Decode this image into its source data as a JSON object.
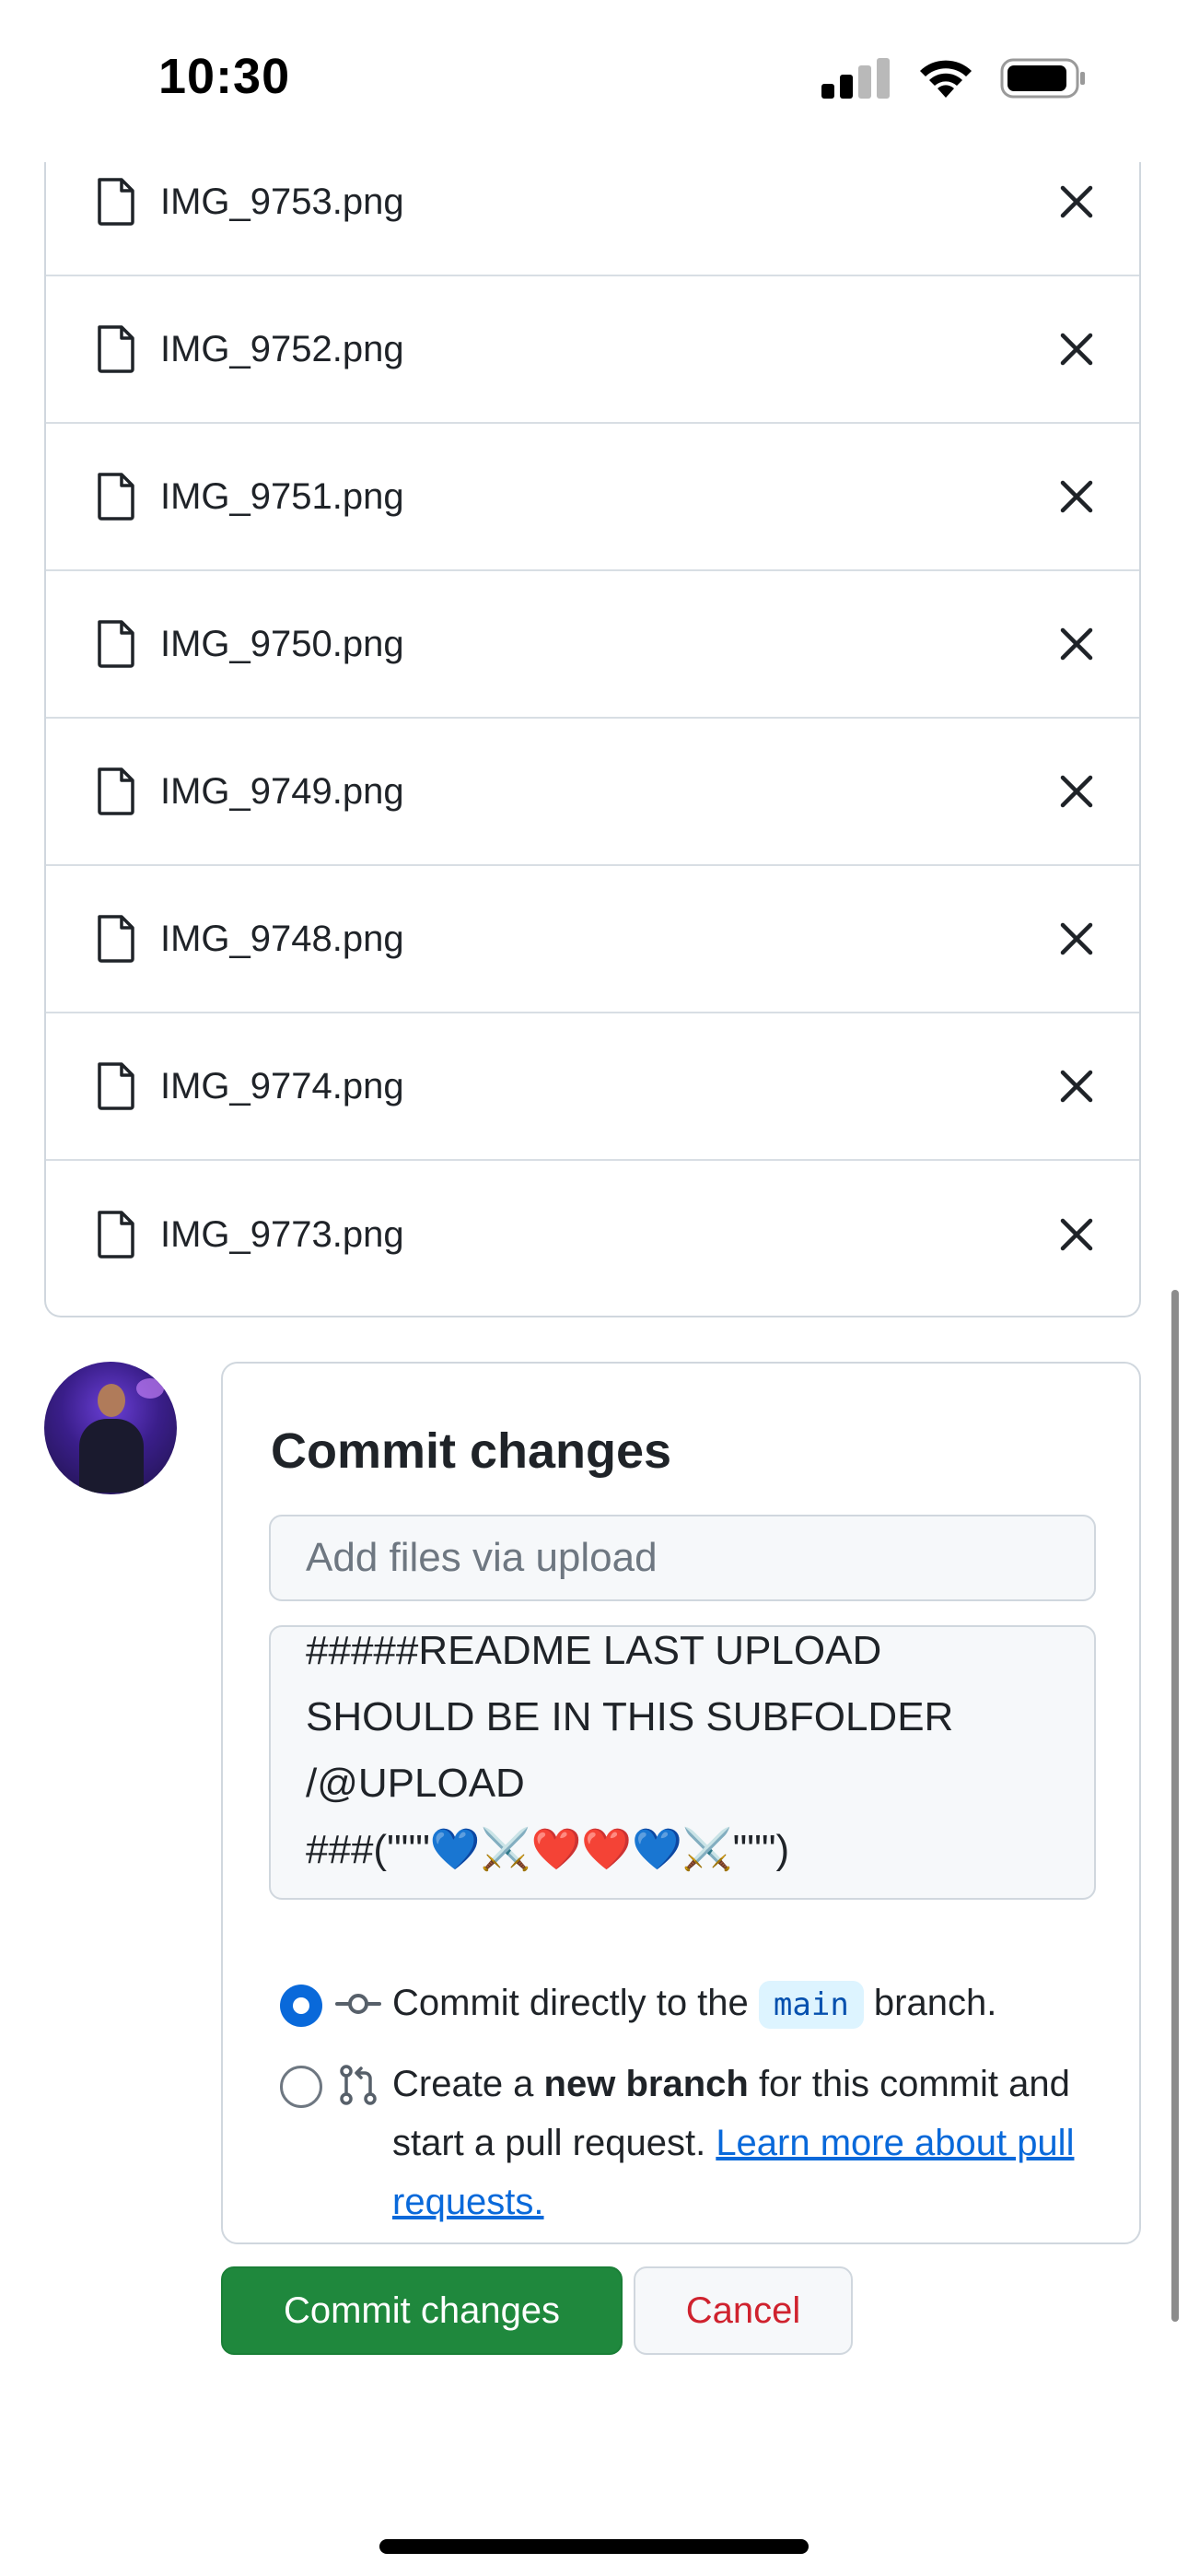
{
  "status_bar": {
    "time": "10:30"
  },
  "files": [
    {
      "name": "IMG_9753.png"
    },
    {
      "name": "IMG_9752.png"
    },
    {
      "name": "IMG_9751.png"
    },
    {
      "name": "IMG_9750.png"
    },
    {
      "name": "IMG_9749.png"
    },
    {
      "name": "IMG_9748.png"
    },
    {
      "name": "IMG_9774.png"
    },
    {
      "name": "IMG_9773.png"
    }
  ],
  "commit": {
    "title": "Commit changes",
    "summary_placeholder": "Add files via upload",
    "description_lines": [
      "#####README LAST UPLOAD",
      "SHOULD BE IN THIS SUBFOLDER",
      "/@UPLOAD",
      "###(\"\"\"💙⚔️❤️❤️💙⚔️\"\"\")"
    ],
    "option_direct": {
      "prefix": "Commit directly to the",
      "branch": "main",
      "suffix": "branch.",
      "selected": true
    },
    "option_new_branch": {
      "prefix": "Create a",
      "bold": "new branch",
      "suffix": "for this commit and start a pull request.",
      "link": "Learn more about pull requests.",
      "selected": false
    },
    "commit_button": "Commit changes",
    "cancel_button": "Cancel"
  },
  "colors": {
    "primary_green": "#1f883d",
    "danger_red": "#cf222e",
    "link_blue": "#0969da"
  }
}
